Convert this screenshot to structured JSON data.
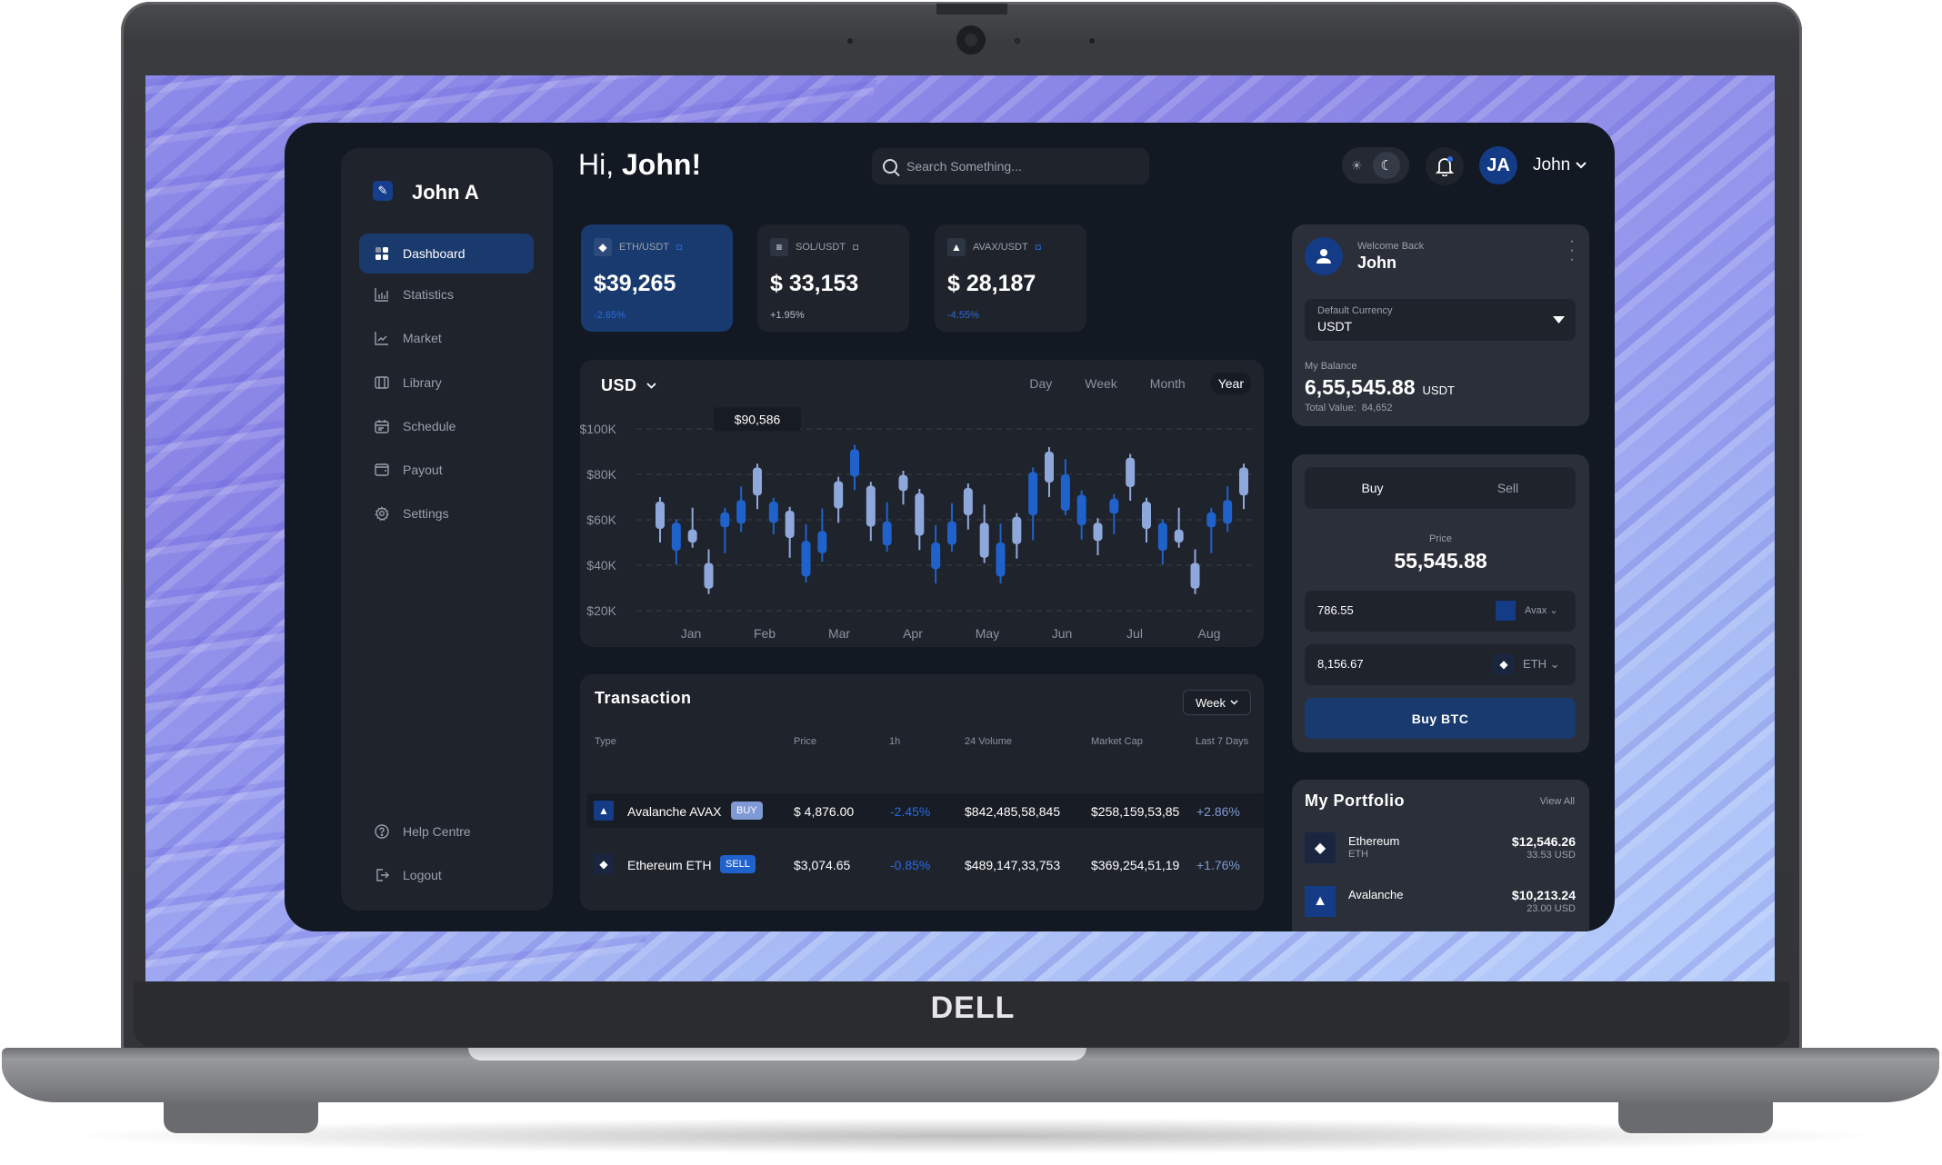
{
  "device": {
    "brand_logo": "DELL"
  },
  "sidebar": {
    "brand_name": "John A",
    "items": [
      {
        "label": "Dashboard",
        "icon": "grid-icon",
        "active": true
      },
      {
        "label": "Statistics",
        "icon": "bar-chart-icon"
      },
      {
        "label": "Market",
        "icon": "line-chart-icon"
      },
      {
        "label": "Library",
        "icon": "book-icon"
      },
      {
        "label": "Schedule",
        "icon": "calendar-icon"
      },
      {
        "label": "Payout",
        "icon": "wallet-icon"
      },
      {
        "label": "Settings",
        "icon": "gear-icon"
      }
    ],
    "bottom_items": [
      {
        "label": "Help Centre",
        "icon": "help-icon"
      },
      {
        "label": "Logout",
        "icon": "logout-icon"
      }
    ]
  },
  "header": {
    "greeting_prefix": "Hi,",
    "greeting_name": "John!",
    "search_placeholder": "Search Something...",
    "avatar_initials": "JA",
    "user_name": "John"
  },
  "tickers": [
    {
      "pair": "ETH/USDT",
      "price": "$39,265",
      "change": "-2.65%",
      "change_color": "#2a6ae0",
      "icon": "ethereum-icon"
    },
    {
      "pair": "SOL/USDT",
      "price": "$ 33,153",
      "change": "+1.95%",
      "change_color": "#b8bec9",
      "icon": "solana-icon"
    },
    {
      "pair": "AVAX/USDT",
      "price": "$ 28,187",
      "change": "-4.55%",
      "change_color": "#2a6ae0",
      "icon": "avalanche-icon"
    }
  ],
  "chart_panel": {
    "currency": "USD",
    "ranges": [
      "Day",
      "Week",
      "Month",
      "Year"
    ],
    "selected_range": "Year"
  },
  "chart_data": {
    "type": "candlestick",
    "title": "",
    "xlabel": "",
    "ylabel": "",
    "ylim": [
      20000,
      100000
    ],
    "y_ticks": [
      "$20K",
      "$40K",
      "$60K",
      "$80K",
      "$100K"
    ],
    "y_tick_values": [
      20000,
      40000,
      60000,
      80000,
      100000
    ],
    "x_tick_labels": [
      "Jan",
      "Feb",
      "Mar",
      "Apr",
      "May",
      "Jun",
      "Jul",
      "Aug"
    ],
    "grid": true,
    "tooltip": {
      "label": "$90,586",
      "candle_index": 6
    },
    "colors": {
      "up": "#8fa8dc",
      "down": "#1f62cc"
    },
    "candles": [
      {
        "h": 70,
        "l": 50,
        "bt": 68,
        "bb": 56,
        "c": "up"
      },
      {
        "h": 60.3,
        "l": 40.3,
        "bt": 58.7,
        "bb": 46.4,
        "c": "down"
      },
      {
        "h": 65.3,
        "l": 47.7,
        "bt": 55.7,
        "bb": 50,
        "c": "up"
      },
      {
        "h": 47,
        "l": 27.3,
        "bt": 41,
        "bb": 29.7,
        "c": "up"
      },
      {
        "h": 65.3,
        "l": 45.3,
        "bt": 63.3,
        "bb": 56.7,
        "c": "down"
      },
      {
        "h": 74.7,
        "l": 54.7,
        "bt": 68.7,
        "bb": 58.3,
        "c": "down"
      },
      {
        "h": 84.7,
        "l": 64.7,
        "bt": 83,
        "bb": 70.7,
        "c": "up"
      },
      {
        "h": 69.7,
        "l": 53.6,
        "bt": 68,
        "bb": 58.7,
        "c": "down"
      },
      {
        "h": 65.7,
        "l": 43.3,
        "bt": 64,
        "bb": 52,
        "c": "up"
      },
      {
        "h": 58,
        "l": 32.4,
        "bt": 50.7,
        "bb": 35,
        "c": "down"
      },
      {
        "h": 65,
        "l": 41.6,
        "bt": 55,
        "bb": 45.3,
        "c": "down"
      },
      {
        "h": 78.9,
        "l": 58.7,
        "bt": 77,
        "bb": 65,
        "c": "up"
      },
      {
        "h": 93,
        "l": 73,
        "bt": 91,
        "bb": 79,
        "c": "down"
      },
      {
        "h": 76.7,
        "l": 50.7,
        "bt": 75,
        "bb": 57,
        "c": "up"
      },
      {
        "h": 67.7,
        "l": 46,
        "bt": 59.3,
        "bb": 48.7,
        "c": "down"
      },
      {
        "h": 81.6,
        "l": 66.7,
        "bt": 79.7,
        "bb": 72.7,
        "c": "up"
      },
      {
        "h": 73.6,
        "l": 46.7,
        "bt": 71.7,
        "bb": 53,
        "c": "up"
      },
      {
        "h": 57.6,
        "l": 32,
        "bt": 50,
        "bb": 38.3,
        "c": "down"
      },
      {
        "h": 67.3,
        "l": 46,
        "bt": 59.3,
        "bb": 49,
        "c": "down"
      },
      {
        "h": 76,
        "l": 55.7,
        "bt": 74,
        "bb": 62,
        "c": "up"
      },
      {
        "h": 66.7,
        "l": 41,
        "bt": 58.7,
        "bb": 43.3,
        "c": "up"
      },
      {
        "h": 58.3,
        "l": 32,
        "bt": 50,
        "bb": 35,
        "c": "down"
      },
      {
        "h": 62.9,
        "l": 42.9,
        "bt": 61.3,
        "bb": 49.3,
        "c": "up"
      },
      {
        "h": 83,
        "l": 51,
        "bt": 81,
        "bb": 62,
        "c": "down"
      },
      {
        "h": 92,
        "l": 70,
        "bt": 90,
        "bb": 76.4,
        "c": "up"
      },
      {
        "h": 86.7,
        "l": 62,
        "bt": 80,
        "bb": 64,
        "c": "down"
      },
      {
        "h": 73,
        "l": 51.3,
        "bt": 71,
        "bb": 57.6,
        "c": "down"
      },
      {
        "h": 60.7,
        "l": 44.4,
        "bt": 58.7,
        "bb": 50.7,
        "c": "up"
      },
      {
        "h": 71.3,
        "l": 53.6,
        "bt": 69.3,
        "bb": 62.7,
        "c": "down"
      },
      {
        "h": 89,
        "l": 68.4,
        "bt": 87.3,
        "bb": 74.4,
        "c": "up"
      },
      {
        "h": 69.7,
        "l": 50,
        "bt": 68,
        "bb": 56,
        "c": "up"
      },
      {
        "h": 60.3,
        "l": 40.3,
        "bt": 58.7,
        "bb": 46.4,
        "c": "down"
      },
      {
        "h": 65.3,
        "l": 47.7,
        "bt": 55.7,
        "bb": 50,
        "c": "up"
      },
      {
        "h": 47,
        "l": 27.3,
        "bt": 41,
        "bb": 29.7,
        "c": "up"
      },
      {
        "h": 65.3,
        "l": 45.3,
        "bt": 63.3,
        "bb": 56.7,
        "c": "down"
      },
      {
        "h": 74.7,
        "l": 54.7,
        "bt": 68.7,
        "bb": 58.3,
        "c": "down"
      },
      {
        "h": 84.7,
        "l": 64.7,
        "bt": 83,
        "bb": 70.7,
        "c": "up"
      }
    ],
    "units_note": "candle values in $K"
  },
  "transactions": {
    "title": "Transaction",
    "period": "Week",
    "columns": [
      "Type",
      "Price",
      "1h",
      "24 Volume",
      "Market Cap",
      "Last 7 Days"
    ],
    "rows": [
      {
        "name": "Avalanche AVAX",
        "badge": "BUY",
        "price": "$ 4,876.00",
        "h1": "-2.45%",
        "volume": "$842,485,58,845",
        "market_cap": "$258,159,53,85",
        "last7": "+2.86%",
        "icon": "avalanche-icon"
      },
      {
        "name": "Ethereum ETH",
        "badge": "SELL",
        "price": "$3,074.65",
        "h1": "-0.85%",
        "volume": "$489,147,33,753",
        "market_cap": "$369,254,51,19",
        "last7": "+1.76%",
        "icon": "ethereum-icon"
      }
    ]
  },
  "profile": {
    "welcome": "Welcome Back",
    "name": "John",
    "currency_label": "Default Currency",
    "currency_value": "USDT",
    "balance_label": "My Balance",
    "balance": "6,55,545.88",
    "balance_unit": "USDT",
    "total_label": "Total Value:",
    "total_value": "84,652"
  },
  "trade": {
    "tabs": [
      "Buy",
      "Sell"
    ],
    "selected_tab": "Buy",
    "price_label": "Price",
    "price": "55,545.88",
    "amount1": "786.55",
    "asset1": "Avax",
    "amount2": "8,156.67",
    "asset2": "ETH",
    "submit_label": "Buy BTC"
  },
  "portfolio": {
    "title": "My Portfolio",
    "view_all": "View All",
    "items": [
      {
        "name": "Ethereum",
        "symbol": "ETH",
        "value": "$12,546.26",
        "sub": "33.53 USD",
        "icon": "ethereum-icon"
      },
      {
        "name": "Avalanche",
        "symbol": "",
        "value": "$10,213.24",
        "sub": "23.00 USD",
        "icon": "avalanche-icon"
      }
    ]
  }
}
